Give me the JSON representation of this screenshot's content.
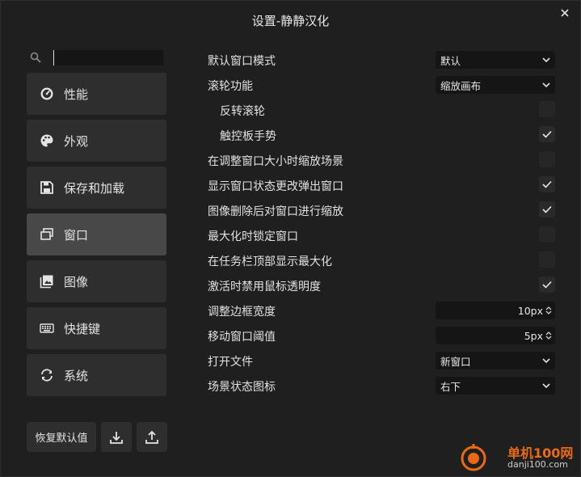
{
  "window": {
    "title": "设置-静静汉化",
    "close_icon": "close-icon"
  },
  "search": {
    "value": "",
    "placeholder": ""
  },
  "nav": {
    "items": [
      {
        "label": "性能",
        "icon": "gauge-icon",
        "active": false
      },
      {
        "label": "外观",
        "icon": "palette-icon",
        "active": false
      },
      {
        "label": "保存和加载",
        "icon": "floppy-icon",
        "active": false
      },
      {
        "label": "窗口",
        "icon": "windows-icon",
        "active": true
      },
      {
        "label": "图像",
        "icon": "image-icon",
        "active": false
      },
      {
        "label": "快捷键",
        "icon": "keyboard-icon",
        "active": false
      },
      {
        "label": "系统",
        "icon": "sync-icon",
        "active": false
      }
    ]
  },
  "footer": {
    "reset_label": "恢复默认值",
    "import_icon": "download-icon",
    "export_icon": "upload-icon"
  },
  "settings": {
    "rows": [
      {
        "label": "默认窗口模式",
        "type": "select",
        "value": "默认"
      },
      {
        "label": "滚轮功能",
        "type": "select",
        "value": "缩放画布"
      },
      {
        "label": "反转滚轮",
        "type": "check",
        "checked": false,
        "indent": true
      },
      {
        "label": "触控板手势",
        "type": "check",
        "checked": true,
        "indent": true
      },
      {
        "label": "在调整窗口大小时缩放场景",
        "type": "check",
        "checked": false
      },
      {
        "label": "显示窗口状态更改弹出窗口",
        "type": "check",
        "checked": true
      },
      {
        "label": "图像删除后对窗口进行缩放",
        "type": "check",
        "checked": true
      },
      {
        "label": "最大化时锁定窗口",
        "type": "check",
        "checked": false
      },
      {
        "label": "在任务栏顶部显示最大化",
        "type": "check",
        "checked": false
      },
      {
        "label": "激活时禁用鼠标透明度",
        "type": "check",
        "checked": true
      },
      {
        "label": "调整边框宽度",
        "type": "spin",
        "value": "10px"
      },
      {
        "label": "移动窗口阈值",
        "type": "spin",
        "value": "5px"
      },
      {
        "label": "打开文件",
        "type": "select",
        "value": "新窗口"
      },
      {
        "label": "场景状态图标",
        "type": "select",
        "value": "右下"
      }
    ]
  },
  "watermark": {
    "name": "单机100网",
    "url": "danji100.com",
    "brand_color": "#e86a17"
  },
  "colors": {
    "background": "#1f1f1f",
    "button": "#2e2e2e",
    "active": "#484848",
    "field": "#151515"
  }
}
